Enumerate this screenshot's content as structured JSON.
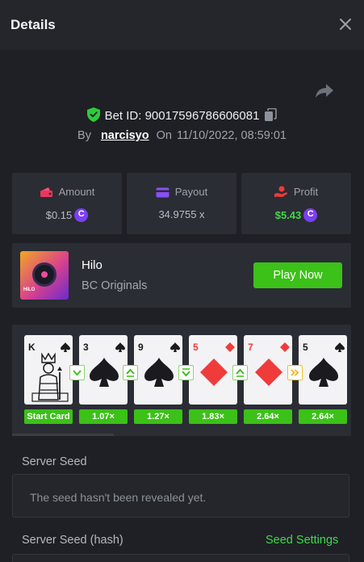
{
  "header": {
    "title": "Details",
    "close_icon": "close-icon"
  },
  "share_icon": "share-icon",
  "bet": {
    "label": "Bet ID:",
    "id": "90017596786606081",
    "by_label": "By",
    "user": "narcisyo",
    "on_label": "On",
    "datetime": "11/10/2022, 08:59:01"
  },
  "stats": {
    "amount": {
      "label": "Amount",
      "value": "$0.15",
      "icon": "wallet-icon"
    },
    "payout": {
      "label": "Payout",
      "value": "34.9755 x",
      "icon": "card-icon"
    },
    "profit": {
      "label": "Profit",
      "value": "$5.43",
      "icon": "hand-coin-icon"
    }
  },
  "game": {
    "name": "Hilo",
    "provider": "BC Originals",
    "play_label": "Play Now",
    "thumb_tag": "HILO"
  },
  "cards": [
    {
      "rank": "K",
      "suit": "spade",
      "multiplier": "Start Card"
    },
    {
      "rank": "3",
      "suit": "spade",
      "multiplier": "1.07×",
      "arrow": "down"
    },
    {
      "rank": "9",
      "suit": "spade",
      "multiplier": "1.27×",
      "arrow": "up"
    },
    {
      "rank": "5",
      "suit": "diamond",
      "multiplier": "1.83×",
      "arrow": "down"
    },
    {
      "rank": "7",
      "suit": "diamond",
      "multiplier": "2.64×",
      "arrow": "up"
    },
    {
      "rank": "5",
      "suit": "spade",
      "multiplier": "2.64×",
      "arrow": "skip"
    }
  ],
  "server_seed": {
    "label": "Server Seed",
    "placeholder": "The seed hasn't been revealed yet."
  },
  "server_seed_hash": {
    "label": "Server Seed (hash)",
    "settings_label": "Seed Settings"
  },
  "colors": {
    "accent_green": "#3bc117",
    "background": "#1e2025",
    "panel": "#2a2d33",
    "diamond_red": "#f03b3b"
  }
}
